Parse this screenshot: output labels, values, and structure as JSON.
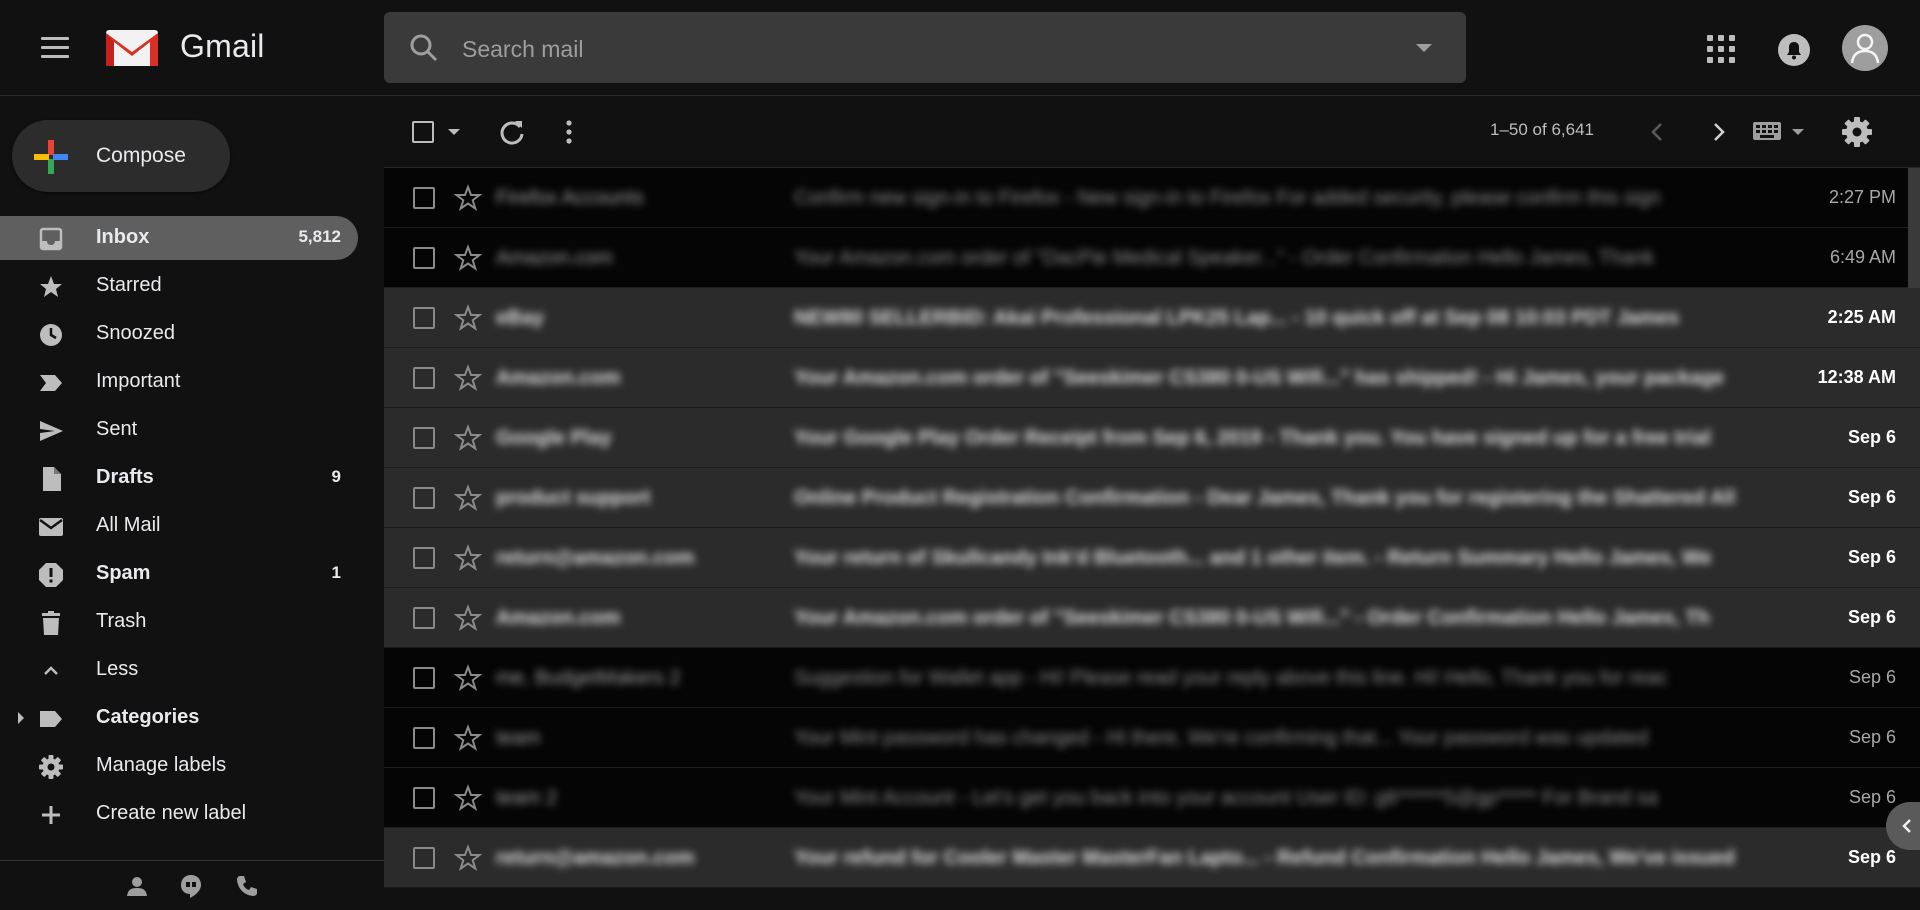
{
  "header": {
    "brand": "Gmail",
    "search_placeholder": "Search mail"
  },
  "sidebar": {
    "compose_label": "Compose",
    "items": [
      {
        "label": "Inbox",
        "count": "5,812",
        "icon": "inbox-icon",
        "bold": true,
        "active": true
      },
      {
        "label": "Starred",
        "count": "",
        "icon": "star-icon"
      },
      {
        "label": "Snoozed",
        "count": "",
        "icon": "clock-icon"
      },
      {
        "label": "Important",
        "count": "",
        "icon": "important-icon"
      },
      {
        "label": "Sent",
        "count": "",
        "icon": "send-icon"
      },
      {
        "label": "Drafts",
        "count": "9",
        "icon": "draft-icon",
        "bold": true
      },
      {
        "label": "All Mail",
        "count": "",
        "icon": "mail-icon"
      },
      {
        "label": "Spam",
        "count": "1",
        "icon": "spam-icon",
        "bold": true
      },
      {
        "label": "Trash",
        "count": "",
        "icon": "trash-icon"
      },
      {
        "label": "Less",
        "count": "",
        "icon": "chevron-up-icon"
      },
      {
        "label": "Categories",
        "count": "",
        "icon": "label-icon",
        "bold": true
      },
      {
        "label": "Manage labels",
        "count": "",
        "icon": "gear-icon"
      },
      {
        "label": "Create new label",
        "count": "",
        "icon": "plus-icon"
      }
    ]
  },
  "toolbar": {
    "pager": "1–50 of 6,641"
  },
  "emails": [
    {
      "sender": "Firefox Accounts",
      "subject": "Confirm new sign-in to Firefox - New sign-in to Firefox For added security, please confirm this sign",
      "date": "2:27 PM",
      "unread": false
    },
    {
      "sender": "Amazon.com",
      "subject": "Your Amazon.com order of \"DacPie Medical Speaker...\" - Order Confirmation Hello James, Thank",
      "date": "6:49 AM",
      "unread": false
    },
    {
      "sender": "eBay",
      "subject": "NEW80 SELLERBID: Akai Professional LPK25 Lap... - 10 quick off at Sep 08 10:03 PDT James",
      "date": "2:25 AM",
      "unread": true
    },
    {
      "sender": "Amazon.com",
      "subject": "Your Amazon.com order of \"Seeskimer CS380 0-US Wifi...\" has shipped! - Hi James, your package",
      "date": "12:38 AM",
      "unread": true
    },
    {
      "sender": "Google Play",
      "subject": "Your Google Play Order Receipt from Sep 6, 2019 - Thank you. You have signed up for a free trial",
      "date": "Sep 6",
      "unread": true
    },
    {
      "sender": "product support",
      "subject": "Online Product Registration Confirmation - Dear James, Thank you for registering the Shattered Ally",
      "date": "Sep 6",
      "unread": true
    },
    {
      "sender": "return@amazon.com",
      "subject": "Your return of Skullcandy Ink'd Bluetooth... and 1 other item. - Return Summary Hello James, We",
      "date": "Sep 6",
      "unread": true
    },
    {
      "sender": "Amazon.com",
      "subject": "Your Amazon.com order of \"Seeskimer CS380 0-US Wifi...\" - Order Confirmation Hello James, Th",
      "date": "Sep 6",
      "unread": true
    },
    {
      "sender": "me, BudgetMakers 2",
      "subject": "Suggestion for Wallet app - Hi! Please read your reply above this line. Hi! Hello, Thank you for reac",
      "date": "Sep 6",
      "unread": false
    },
    {
      "sender": "team",
      "subject": "Your Mint password has changed - Hi there, We're confirming that... Your password was updated",
      "date": "Sep 6",
      "unread": false
    },
    {
      "sender": "team 2",
      "subject": "Your Mint Account - Let's get you back into your account User ID: g6******5@gp***** For Brand sa",
      "date": "Sep 6",
      "unread": false
    },
    {
      "sender": "return@amazon.com",
      "subject": "Your refund for Cooler Master MasterFan Lapto... - Refund Confirmation Hello James, We've issued",
      "date": "Sep 6",
      "unread": true
    }
  ]
}
